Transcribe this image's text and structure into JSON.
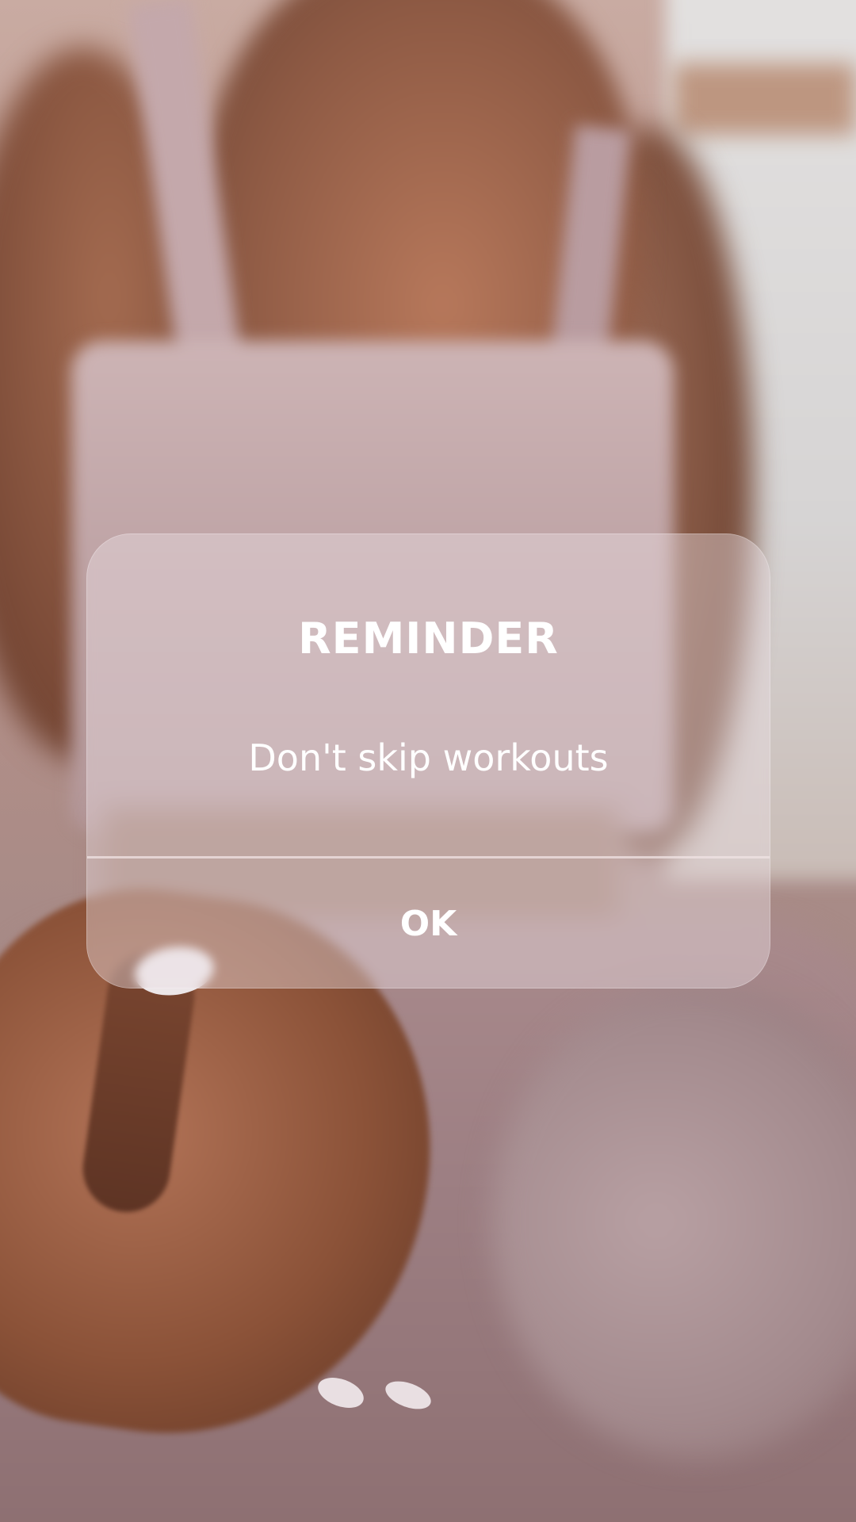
{
  "dialog": {
    "title": "REMINDER",
    "message": "Don't skip workouts",
    "ok_label": "OK"
  },
  "colors": {
    "text": "#ffffff",
    "dialog_bg": "rgba(235,225,228,0.42)",
    "divider": "#f0e4e4"
  }
}
